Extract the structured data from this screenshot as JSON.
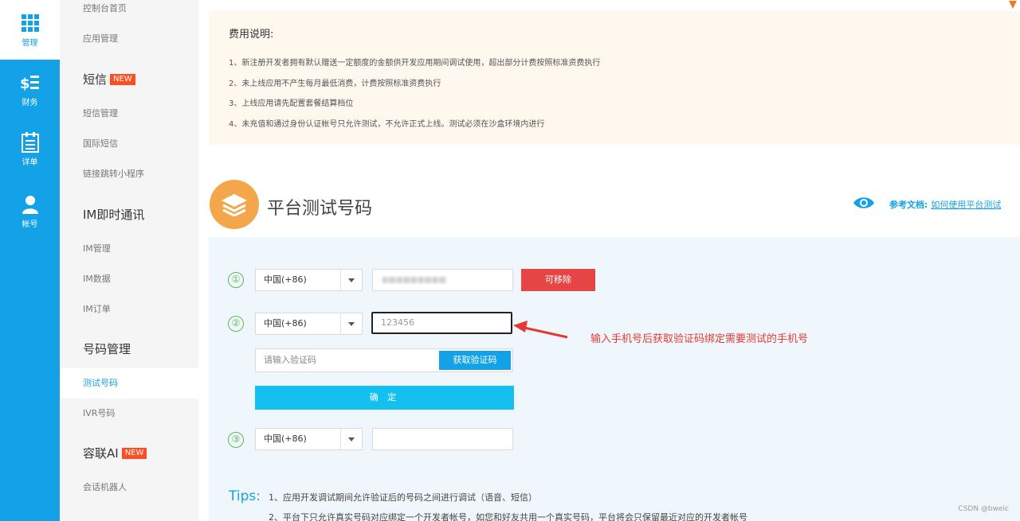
{
  "rail": [
    {
      "label": "管理",
      "icon": "grid-icon",
      "active": true
    },
    {
      "label": "财务",
      "icon": "finance-icon",
      "active": false
    },
    {
      "label": "详单",
      "icon": "list-icon",
      "active": false
    },
    {
      "label": "帐号",
      "icon": "user-icon",
      "active": false
    }
  ],
  "sidebar": {
    "console_home": "控制台首页",
    "app_manage": "应用管理",
    "sms_group": "短信",
    "new_badge": "NEW",
    "sms_manage": "短信管理",
    "intl_sms": "国际短信",
    "link_mini": "链接跳转小程序",
    "im_group": "IM即时通讯",
    "im_manage": "IM管理",
    "im_data": "IM数据",
    "im_order": "IM订单",
    "number_group": "号码管理",
    "test_number": "测试号码",
    "ivr_number": "IVR号码",
    "ai_group": "容联AI",
    "chatbot": "会话机器人"
  },
  "notice": {
    "title": "费用说明:",
    "lines": [
      "1、新注册开发者拥有默认赠送一定额度的金额供开发应用期间调试使用，超出部分计费按照标准资费执行",
      "2、未上线应用不产生每月最低消费，计费按照标准资费执行",
      "3、上线应用请先配置套餐结算档位",
      "4、未充值和通过身份认证帐号只允许测试，不允许正式上线。测试必须在沙盒环境内进行"
    ]
  },
  "section": {
    "title": "平台测试号码",
    "ref_label": "参考文档:",
    "ref_link": "如何使用平台测试"
  },
  "form": {
    "row1": {
      "num": "①",
      "country": "中国(+86)",
      "remove_label": "可移除"
    },
    "row2": {
      "num": "②",
      "country": "中国(+86)",
      "phone_value": "123456",
      "code_placeholder": "请输入验证码",
      "get_code_label": "获取验证码",
      "confirm_label": "确 定"
    },
    "row3": {
      "num": "③",
      "country": "中国(+86)",
      "phone_value": ""
    }
  },
  "annotation": "输入手机号后获取验证码绑定需要测试的手机号",
  "tips": {
    "label": "Tips:",
    "lines": [
      "1、应用开发调试期间允许验证后的号码之间进行调试（语音、短信）",
      "2、平台下只允许真实号码对应绑定一个开发者帐号，如您和好友共用一个真实号码，平台将会只保留最近对应的开发者帐号"
    ]
  },
  "watermark": "CSDN @bweic",
  "colors": {
    "accent": "#13a2e8",
    "danger": "#e64545",
    "success": "#5bbd4f",
    "warning": "#f3a74a"
  }
}
